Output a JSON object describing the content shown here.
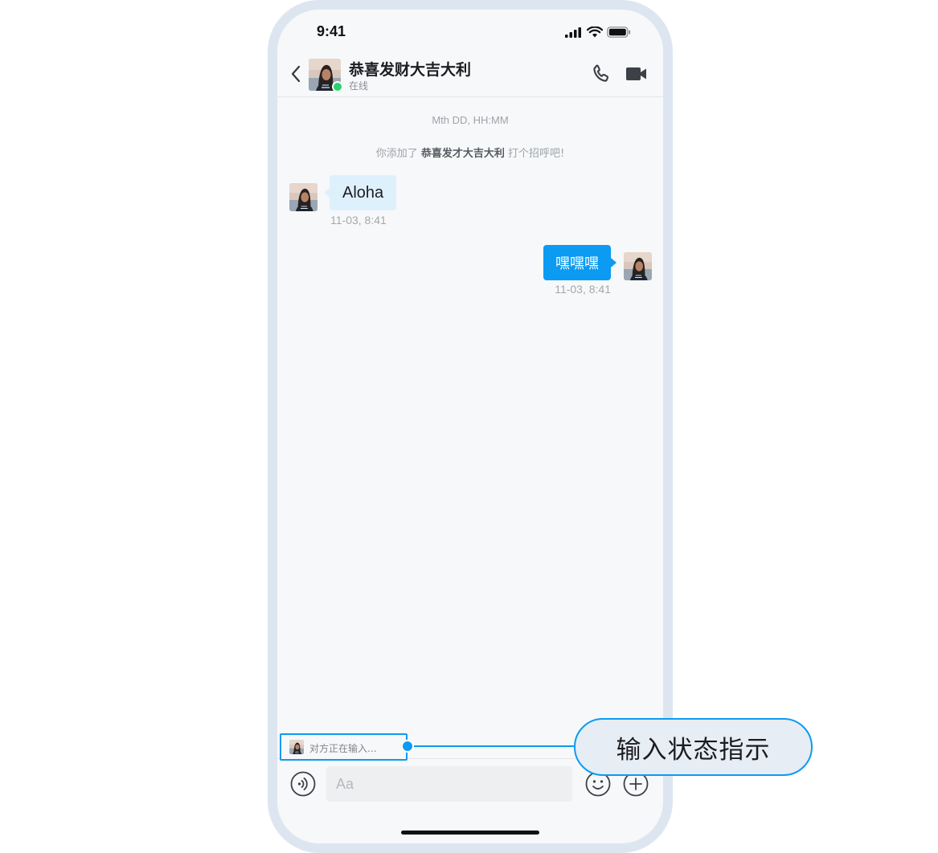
{
  "status_bar": {
    "time": "9:41"
  },
  "header": {
    "contact_name": "恭喜发财大吉大利",
    "contact_status": "在线",
    "icons": {
      "back": "chevron-left-icon",
      "call": "phone-icon",
      "video": "video-camera-icon"
    }
  },
  "conversation": {
    "system_time": "Mth DD, HH:MM",
    "system_notice": {
      "prefix": "你添加了",
      "name": "恭喜发才大吉大利",
      "suffix": "打个招呼吧!"
    },
    "messages": [
      {
        "direction": "incoming",
        "text": "Aloha",
        "time": "11-03, 8:41"
      },
      {
        "direction": "outgoing",
        "text": "嘿嘿嘿",
        "time": "11-03, 8:41"
      }
    ]
  },
  "typing_indicator": {
    "text": "对方正在输入..."
  },
  "input_bar": {
    "placeholder": "Aa",
    "value": "",
    "icons": {
      "voice": "voice-icon",
      "emoji": "emoji-icon",
      "plus": "plus-circle-icon"
    }
  },
  "callout": {
    "label": "输入状态指示"
  },
  "colors": {
    "accent": "#0b9bf2",
    "incoming_bubble": "#dff0fd",
    "online": "#27d36a",
    "frame": "#dde6f0",
    "callout_fill": "#e6edf4"
  }
}
